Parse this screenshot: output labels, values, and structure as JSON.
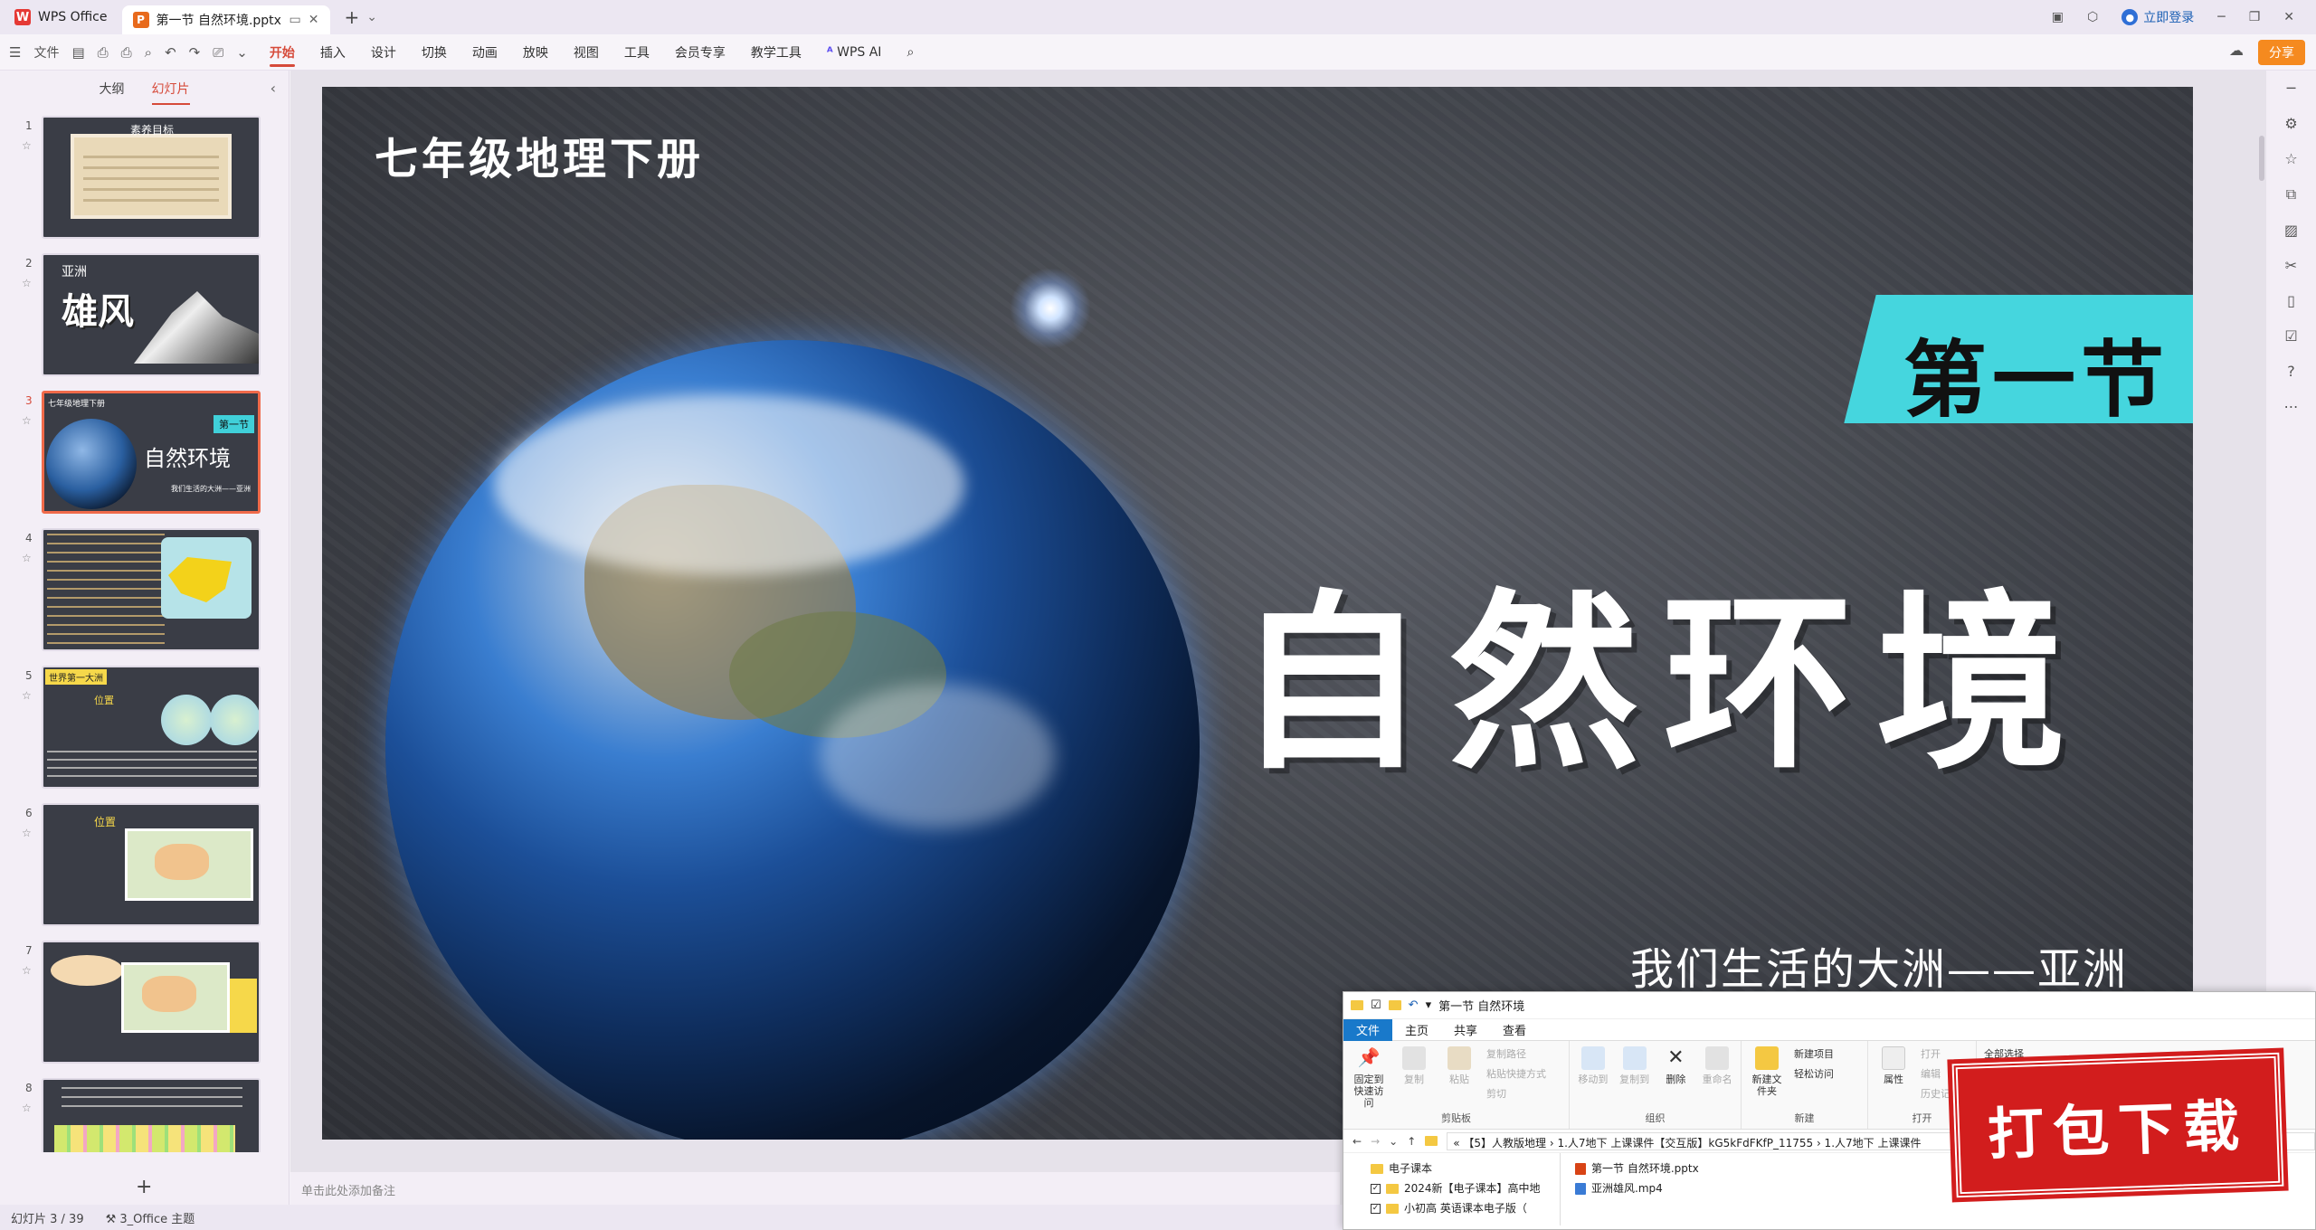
{
  "titlebar": {
    "app_name": "WPS Office",
    "doc_tab_title": "第一节 自然环境.pptx",
    "login_label": "立即登录"
  },
  "ribbon": {
    "file_menu": "文件",
    "tabs": [
      "开始",
      "插入",
      "设计",
      "切换",
      "动画",
      "放映",
      "视图",
      "工具",
      "会员专享",
      "教学工具"
    ],
    "ai_label": "WPS AI",
    "share_label": "分享"
  },
  "panel": {
    "tab_outline": "大纲",
    "tab_slides": "幻灯片",
    "thumbnails": [
      {
        "num": "1",
        "title": "素养目标"
      },
      {
        "num": "2",
        "title": "亚洲雄风",
        "big": "雄风",
        "small": "亚洲"
      },
      {
        "num": "3",
        "title": "自然环境",
        "tag": "第一节",
        "small": "七年级地理下册",
        "sub": "我们生活的大洲——亚洲"
      },
      {
        "num": "4",
        "title": ""
      },
      {
        "num": "5",
        "title": "位置",
        "header": "世界第一大洲"
      },
      {
        "num": "6",
        "title": "位置"
      },
      {
        "num": "7",
        "title": ""
      },
      {
        "num": "8",
        "title": ""
      }
    ],
    "add_slide": "+"
  },
  "slide": {
    "top_title": "七年级地理下册",
    "badge": "第一节",
    "main_title": "自然环境",
    "subtitle": "我们生活的大洲——亚洲"
  },
  "notes_placeholder": "单击此处添加备注",
  "status": {
    "slide_counter": "幻灯片 3 / 39",
    "theme": "3_Office 主题"
  },
  "explorer": {
    "title": "第一节 自然环境",
    "tabs": [
      "文件",
      "主页",
      "共享",
      "查看"
    ],
    "groups": {
      "clipboard": {
        "label": "剪贴板",
        "pin": "固定到快速访问",
        "copy": "复制",
        "paste": "粘贴",
        "copy_path": "复制路径",
        "paste_shortcut": "粘贴快捷方式",
        "cut": "剪切"
      },
      "organize": {
        "label": "组织",
        "move_to": "移动到",
        "copy_to": "复制到",
        "delete": "删除",
        "rename": "重命名"
      },
      "new": {
        "label": "新建",
        "new_folder": "新建文件夹",
        "new_item": "新建项目",
        "easy_access": "轻松访问"
      },
      "open": {
        "label": "打开",
        "properties": "属性",
        "open": "打开",
        "edit": "编辑",
        "history": "历史记录"
      },
      "select": {
        "select_all": "全部选择"
      }
    },
    "address": "«  【5】人教版地理  ›  1.人7地下 上课课件【交互版】kG5kFdFKfP_11755  ›  1.人7地下 上课课件",
    "nav": [
      {
        "label": "电子课本",
        "checked": false
      },
      {
        "label": "2024新【电子课本】高中地",
        "checked": true
      },
      {
        "label": "小初高 英语课本电子版（",
        "checked": true
      }
    ],
    "files": [
      {
        "name": "第一节 自然环境.pptx",
        "type": "pptx"
      },
      {
        "name": "亚洲雄风.mp4",
        "type": "mp4"
      }
    ]
  },
  "stamp": "打包下载",
  "colors": {
    "accent_red": "#d64a3a",
    "badge_cyan": "#45d6de",
    "share_orange": "#f58a1f",
    "stamp_red": "#d21d1d"
  }
}
